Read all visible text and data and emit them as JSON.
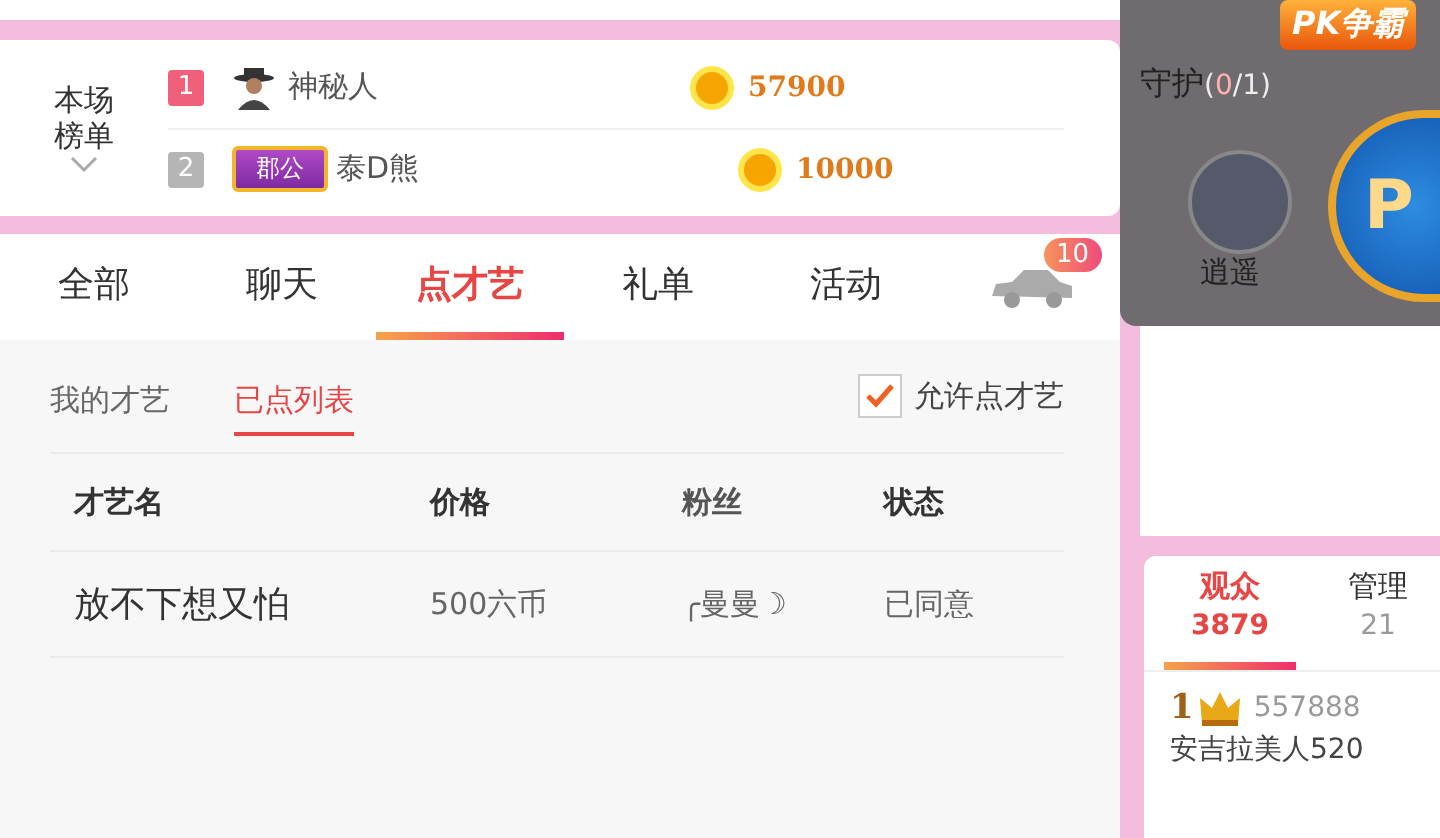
{
  "ranking": {
    "label": "本场榜单",
    "rows": [
      {
        "rank": "1",
        "color": "#f0607a",
        "badge": null,
        "name": "神秘人",
        "coins": "57900"
      },
      {
        "rank": "2",
        "color": "#b5b5b5",
        "badge": "郡公",
        "name": "泰D熊",
        "coins": "10000"
      }
    ]
  },
  "tabs": [
    {
      "label": "全部",
      "selected": false
    },
    {
      "label": "聊天",
      "selected": false
    },
    {
      "label": "点才艺",
      "selected": true
    },
    {
      "label": "礼单",
      "selected": false
    },
    {
      "label": "活动",
      "selected": false
    }
  ],
  "car_badge": "10",
  "subtabs": [
    {
      "label": "我的才艺",
      "selected": false
    },
    {
      "label": "已点列表",
      "selected": true
    }
  ],
  "allow": {
    "label": "允许点才艺",
    "checked": true
  },
  "table": {
    "columns": [
      "才艺名",
      "价格",
      "粉丝",
      "状态"
    ],
    "rows": [
      [
        "放不下想又怕",
        "500六币",
        "╭曼曼☽",
        "已同意"
      ]
    ]
  },
  "pk_banner": "PK争霸",
  "guard": {
    "title": "守护",
    "count_current": "0",
    "count_total": "/1)",
    "open": "(",
    "users": [
      {
        "name": "逍遥"
      }
    ],
    "pk_button": "P"
  },
  "audience": {
    "tabs": [
      {
        "label": "观众",
        "count": "3879",
        "selected": true
      },
      {
        "label": "管理",
        "count": "21",
        "selected": false
      }
    ],
    "items": [
      {
        "rank": "1",
        "id": "557888",
        "name": "安吉拉美人520"
      }
    ]
  }
}
